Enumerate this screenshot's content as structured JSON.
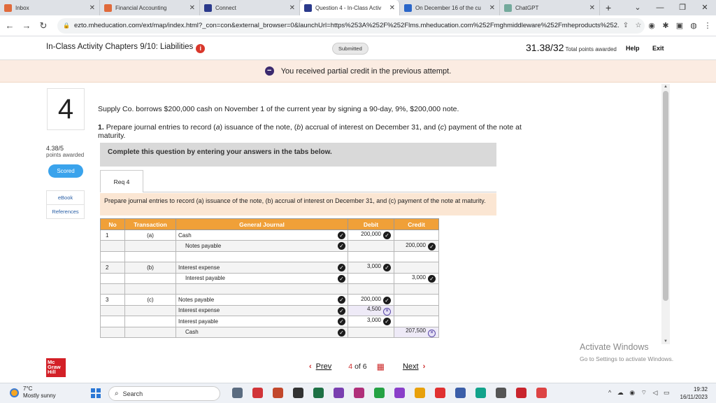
{
  "browser": {
    "tabs": [
      {
        "label": "Inbox",
        "icon_color": "#e06a3b",
        "active": false
      },
      {
        "label": "Financial Accounting",
        "icon_color": "#e06a3b",
        "active": false
      },
      {
        "label": "Connect",
        "icon_color": "#2b3a8c",
        "active": false
      },
      {
        "label": "Question 4 - In-Class Activ",
        "icon_color": "#2b3a8c",
        "active": true
      },
      {
        "label": "On December 16 of the cu",
        "icon_color": "#2a66c9",
        "active": false
      },
      {
        "label": "ChatGPT",
        "icon_color": "#74aa9c",
        "active": false
      }
    ],
    "url": "ezto.mheducation.com/ext/map/index.html?_con=con&external_browser=0&launchUrl=https%253A%252F%252Flms.mheducation.com%252Fmghmiddleware%252Fmheproducts%252..."
  },
  "header": {
    "title": "In-Class Activity Chapters 9/10: Liabilities",
    "status": "Submitted",
    "score": "31.38/32",
    "score_label": "Total points awarded",
    "help": "Help",
    "exit": "Exit"
  },
  "banner": {
    "message": "You received partial credit in the previous attempt."
  },
  "question": {
    "number": "4",
    "points": "4.38/5",
    "points_label": "points awarded",
    "scored_label": "Scored",
    "links": [
      "eBook",
      "References"
    ],
    "text": "Supply Co. borrows $200,000 cash on November 1 of the current year by signing a 90-day, 9%, $200,000 note.",
    "part_number": "1.",
    "part_text_1": "Prepare journal entries to record (",
    "part_a": "a",
    "part_text_2": ") issuance of the note, (",
    "part_b": "b",
    "part_text_3": ") accrual of interest on December 31, and (",
    "part_c": "c",
    "part_text_4": ") payment of the note at maturity.",
    "complete_note": "Complete this question by entering your answers in the tabs below.",
    "req_tab": "Req 4",
    "instruction": "Prepare journal entries to record (a) issuance of the note, (b) accrual of interest on December 31, and (c) payment of the note at maturity."
  },
  "table": {
    "headers": [
      "No",
      "Transaction",
      "General Journal",
      "Debit",
      "Credit"
    ],
    "rows": [
      {
        "no": "1",
        "tx": "(a)",
        "account": "Cash",
        "indent": false,
        "debit": "200,000",
        "debit_mark": "check",
        "credit": "",
        "credit_mark": ""
      },
      {
        "no": "",
        "tx": "",
        "account": "Notes payable",
        "indent": true,
        "debit": "",
        "debit_mark": "",
        "credit": "200,000",
        "credit_mark": "check"
      },
      {
        "no": "",
        "tx": "",
        "account": "",
        "indent": false,
        "debit": "",
        "debit_mark": "",
        "credit": "",
        "credit_mark": "",
        "blank": true
      },
      {
        "no": "2",
        "tx": "(b)",
        "account": "Interest expense",
        "indent": false,
        "debit": "3,000",
        "debit_mark": "check",
        "credit": "",
        "credit_mark": ""
      },
      {
        "no": "",
        "tx": "",
        "account": "Interest payable",
        "indent": true,
        "debit": "",
        "debit_mark": "",
        "credit": "3,000",
        "credit_mark": "check"
      },
      {
        "no": "",
        "tx": "",
        "account": "",
        "indent": false,
        "debit": "",
        "debit_mark": "",
        "credit": "",
        "credit_mark": "",
        "blank": true
      },
      {
        "no": "3",
        "tx": "(c)",
        "account": "Notes payable",
        "indent": false,
        "debit": "200,000",
        "debit_mark": "check",
        "credit": "",
        "credit_mark": ""
      },
      {
        "no": "",
        "tx": "",
        "account": "Interest expense",
        "indent": false,
        "debit": "4,500",
        "debit_mark": "x",
        "credit": "",
        "credit_mark": ""
      },
      {
        "no": "",
        "tx": "",
        "account": "Interest payable",
        "indent": false,
        "debit": "3,000",
        "debit_mark": "check",
        "credit": "",
        "credit_mark": ""
      },
      {
        "no": "",
        "tx": "",
        "account": "Cash",
        "indent": true,
        "debit": "",
        "debit_mark": "",
        "credit": "207,500",
        "credit_mark": "x"
      }
    ]
  },
  "footer": {
    "logo": "Mc Graw Hill",
    "prev": "Prev",
    "current": "4",
    "of": "of",
    "total": "6",
    "next": "Next",
    "activate_title": "Activate Windows",
    "activate_sub": "Go to Settings to activate Windows."
  },
  "taskbar": {
    "temp": "7°C",
    "weather": "Mostly sunny",
    "search": "Search",
    "time": "19:32",
    "date": "16/11/2023"
  }
}
